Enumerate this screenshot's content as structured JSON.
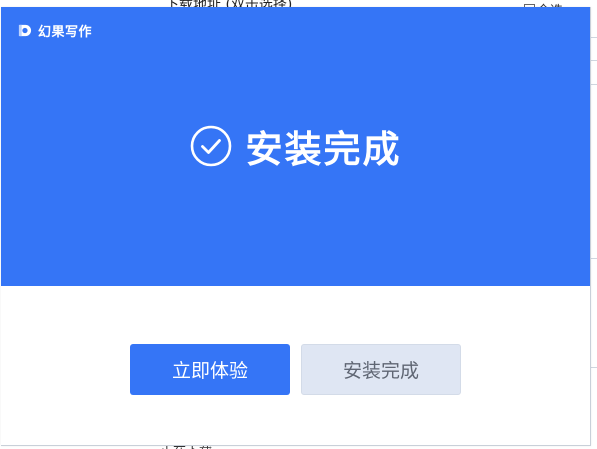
{
  "background": {
    "download_label": "下载地址 (双击选择)",
    "select_all_label": "全选",
    "footer_label": "正在下载..."
  },
  "brand": {
    "name": "幻果写作"
  },
  "status": {
    "text": "安装完成"
  },
  "buttons": {
    "primary_label": "立即体验",
    "secondary_label": "安装完成"
  },
  "colors": {
    "accent": "#3575f6",
    "secondary_bg": "#dfe6f3",
    "secondary_text": "#5f6673"
  }
}
